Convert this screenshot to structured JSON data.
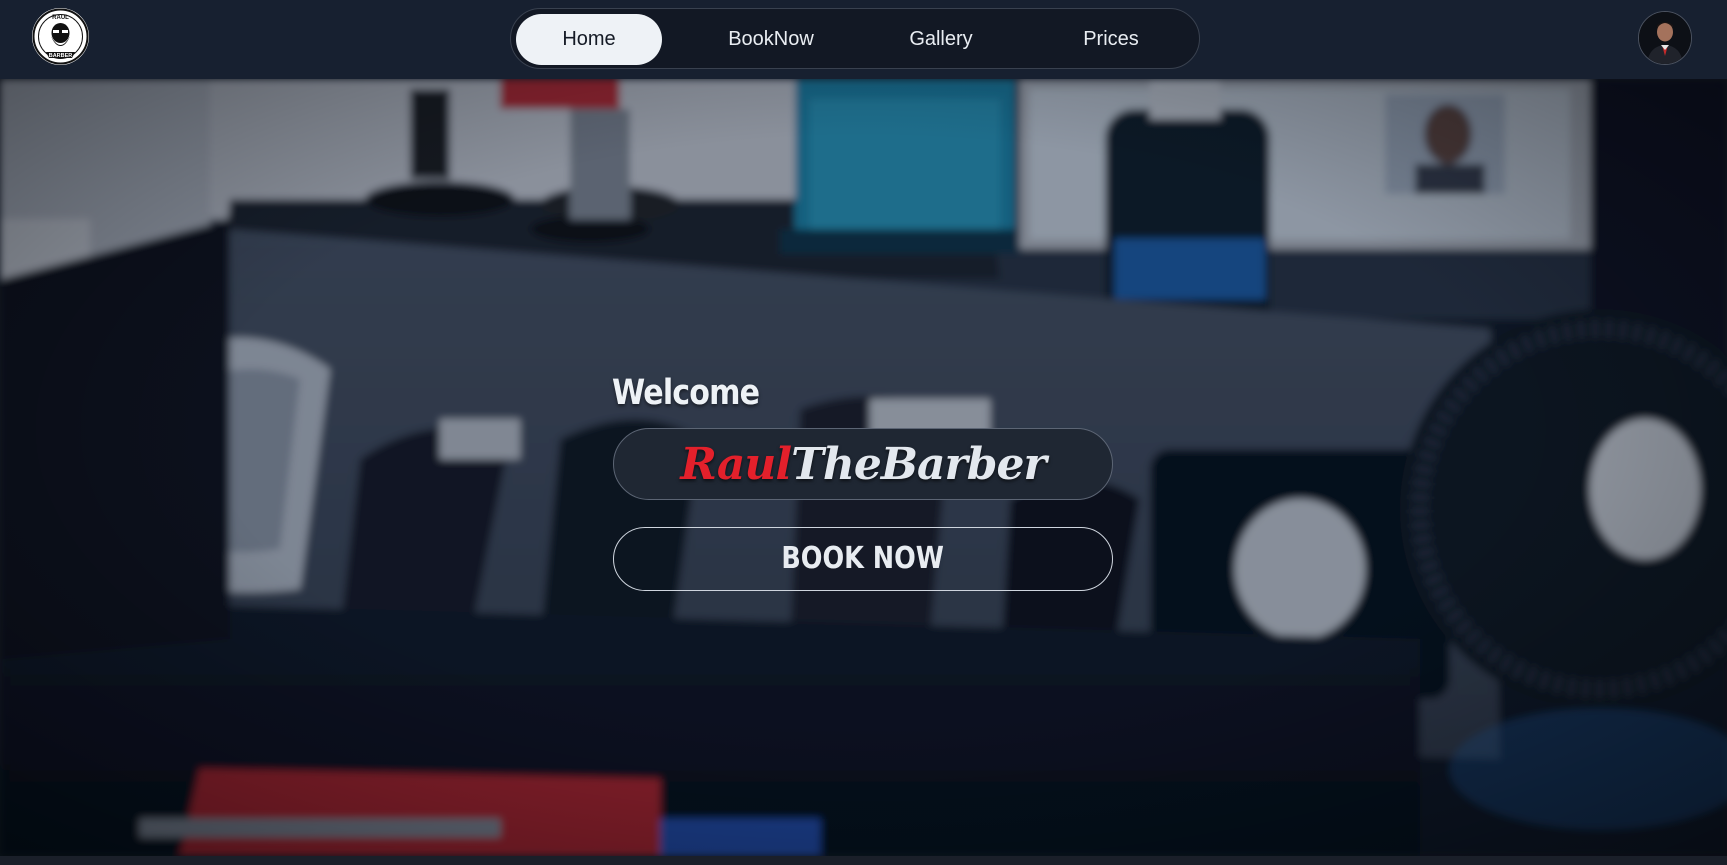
{
  "nav": {
    "logo": {
      "icon": "barber-logo",
      "text_top": "RAUL",
      "text_bottom": "BARBER"
    },
    "items": [
      {
        "label": "Home",
        "active": true
      },
      {
        "label": "BookNow",
        "active": false
      },
      {
        "label": "Gallery",
        "active": false
      },
      {
        "label": "Prices",
        "active": false
      }
    ],
    "avatar": {
      "icon": "profile-avatar"
    }
  },
  "hero": {
    "background": "blurred barber tools photo",
    "welcome": "Welcome",
    "brand_first": "Raul",
    "brand_second": "TheBarber",
    "book_button": "BOOK NOW"
  },
  "colors": {
    "navbar": "#172030",
    "nav_active_bg": "#eef2f6",
    "brand_red": "#e3202b",
    "pill_bg": "#1f2733"
  }
}
